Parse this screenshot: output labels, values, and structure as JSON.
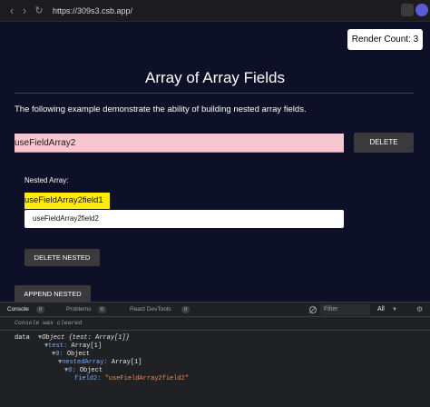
{
  "browser": {
    "url": "https://309s3.csb.app/",
    "back_icon": "chevron-left",
    "forward_icon": "chevron-right",
    "reload_icon": "reload"
  },
  "app": {
    "render_count": "Render Count: 3",
    "title": "Array of Array Fields",
    "description": "The following example demonstrate the ability of building nested array fields.",
    "outer_field_value": "useFieldArray2",
    "delete_label": "DELETE",
    "nested_label": "Nested Array:",
    "nested_fields": [
      "useFieldArray2field1",
      "useFieldArray2field2"
    ],
    "delete_nested_label": "DELETE NESTED",
    "append_nested_label": "APPEND NESTED"
  },
  "devtools": {
    "tabs": [
      {
        "label": "Console",
        "badge": "0"
      },
      {
        "label": "Problems",
        "badge": "0"
      },
      {
        "label": "React DevTools",
        "badge": "0"
      }
    ],
    "filter_placeholder": "Filter",
    "level": "All",
    "cleared_message": "Console was cleared",
    "log": {
      "label": "data",
      "line1_triangle": "▼",
      "line1_text": "Object {test: Array[1]}",
      "line2_key": "test:",
      "line2_value": "Array[1]",
      "line3_key": "0:",
      "line3_value": "Object",
      "line4_key": "nestedArray:",
      "line4_value": "Array[1]",
      "line5_key": "0:",
      "line5_value": "Object",
      "line6_key": "field2:",
      "line6_value": "\"useFieldArray2field2\""
    }
  },
  "colors": {
    "app_bg": "#0d1027",
    "outer_input_bg": "#f7c6d0",
    "nested_highlight": "#ffee00",
    "button_bg": "#3a3a3c"
  }
}
